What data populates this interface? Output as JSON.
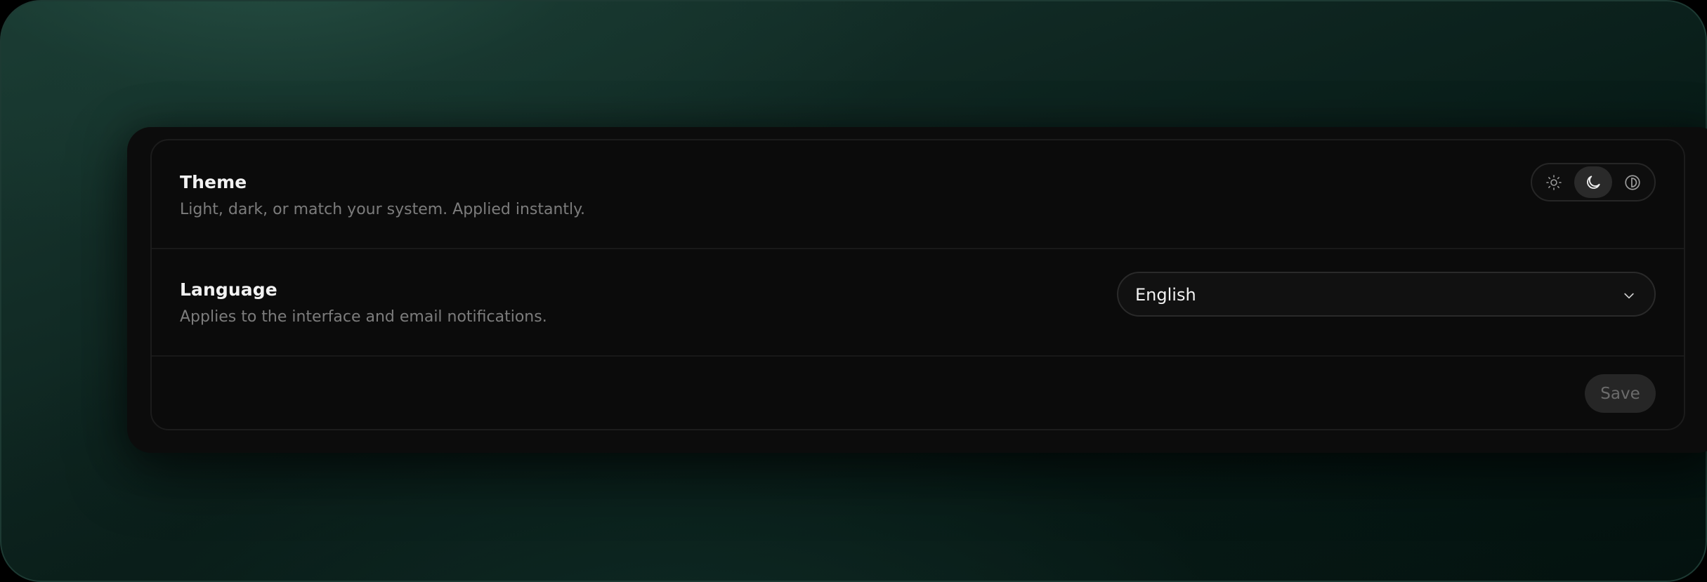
{
  "settings": {
    "theme": {
      "title": "Theme",
      "description": "Light, dark, or match your system. Applied instantly.",
      "options": [
        {
          "icon": "sun-icon",
          "selected": false
        },
        {
          "icon": "moon-icon",
          "selected": true
        },
        {
          "icon": "contrast-icon",
          "selected": false
        }
      ]
    },
    "language": {
      "title": "Language",
      "description": "Applies to the interface and email notifications.",
      "selected": "English"
    },
    "actions": {
      "save_label": "Save",
      "save_enabled": false
    }
  },
  "colors": {
    "background_accent": "#1a3a32",
    "panel": "#0b0b0b",
    "text_primary": "#f2f2f2",
    "text_secondary": "#7c7c7c"
  }
}
